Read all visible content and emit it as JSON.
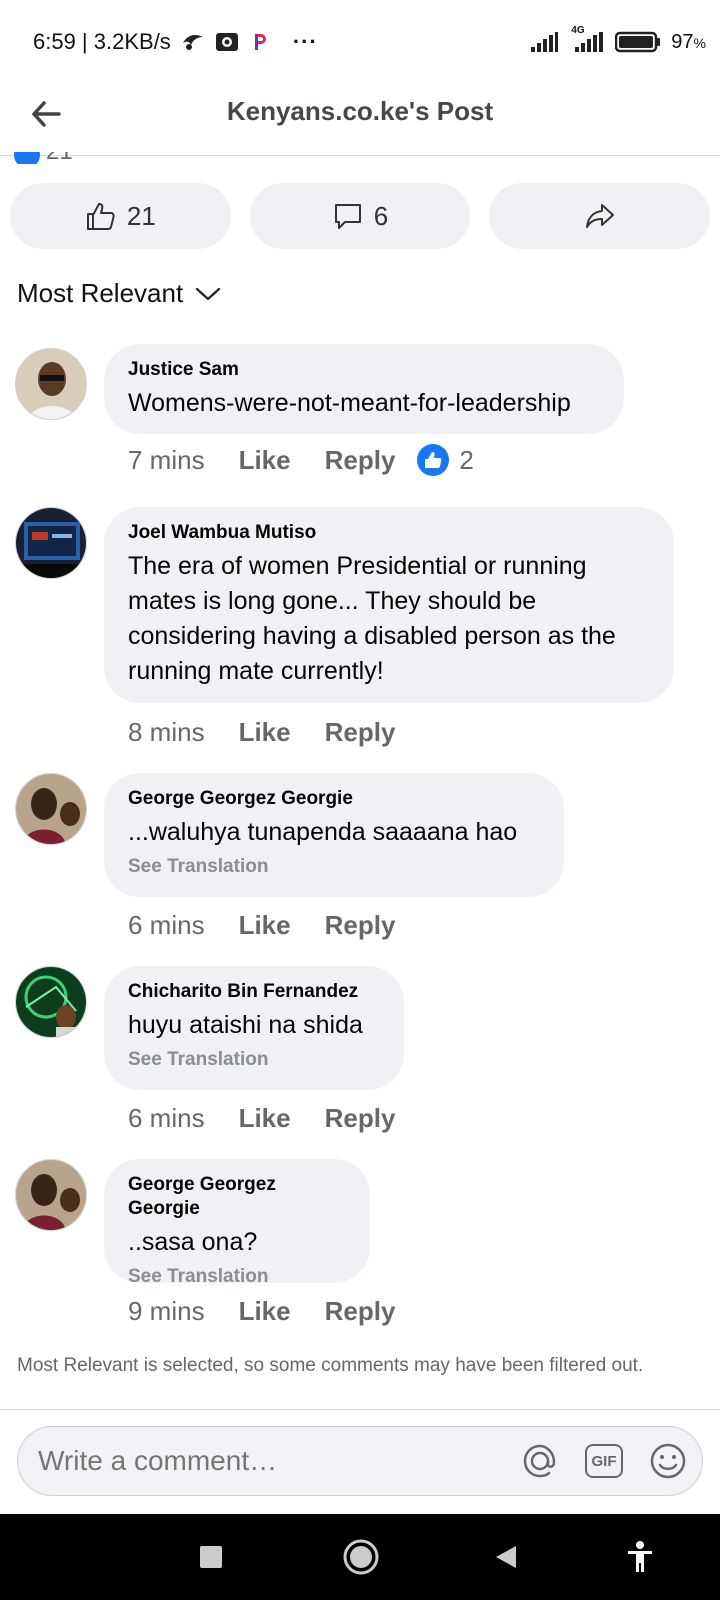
{
  "status_bar": {
    "time_speed": "6:59 | 3.2KB/s",
    "more": "···",
    "network_label": "4G",
    "battery": "97",
    "battery_unit": "%"
  },
  "header": {
    "title": "Kenyans.co.ke's Post",
    "peek_text": "21"
  },
  "actions": {
    "like_count": "21",
    "comment_count": "6"
  },
  "sort": {
    "label": "Most Relevant"
  },
  "comments": [
    {
      "name": "Justice Sam",
      "text": "Womens-were-not-meant-for-leadership",
      "time": "7 mins",
      "like": "Like",
      "reply": "Reply",
      "reaction_count": "2"
    },
    {
      "name": "Joel Wambua Mutiso",
      "text": "The era of women Presidential or running mates is long gone... They should be considering having a disabled person as the running mate currently!",
      "time": "8 mins",
      "like": "Like",
      "reply": "Reply"
    },
    {
      "name": "George Georgez Georgie",
      "text": "...waluhya tunapenda saaaana hao",
      "translate": "See Translation",
      "time": "6 mins",
      "like": "Like",
      "reply": "Reply"
    },
    {
      "name": "Chicharito Bin Fernandez",
      "text": "huyu ataishi na shida",
      "translate": "See Translation",
      "time": "6 mins",
      "like": "Like",
      "reply": "Reply"
    },
    {
      "name": "George Georgez Georgie",
      "text": "..sasa ona?",
      "translate": "See Translation",
      "time": "9 mins",
      "like": "Like",
      "reply": "Reply"
    }
  ],
  "filter_note": "Most Relevant is selected, so some comments may have been filtered out.",
  "composer": {
    "placeholder": "Write a comment…",
    "gif_label": "GIF"
  },
  "colors": {
    "accent": "#1877f2",
    "bubble": "#eff1f4",
    "secondary_text": "#65676b"
  }
}
